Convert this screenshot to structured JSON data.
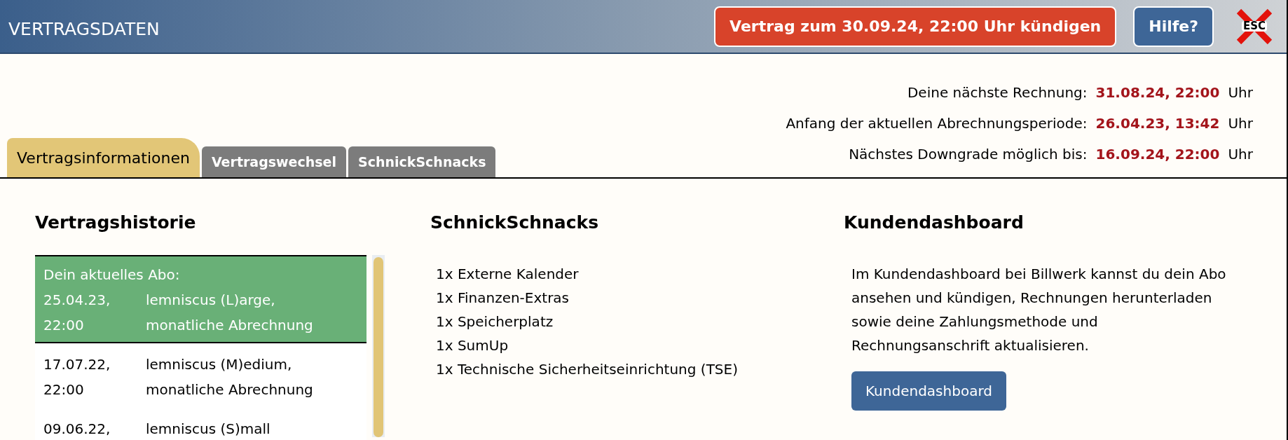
{
  "header": {
    "title": "VERTRAGSDATEN",
    "cancel_button": "Vertrag zum 30.09.24, 22:00 Uhr kündigen",
    "help_button": "Hilfe?",
    "esc_label": "ESC"
  },
  "info": [
    {
      "label": "Deine nächste Rechnung:",
      "value": "31.08.24, 22:00",
      "unit": "Uhr"
    },
    {
      "label": "Anfang der aktuellen Abrechnungsperiode:",
      "value": "26.04.23, 13:42",
      "unit": "Uhr"
    },
    {
      "label": "Nächstes Downgrade möglich bis:",
      "value": "16.09.24, 22:00",
      "unit": "Uhr"
    }
  ],
  "tabs": [
    {
      "label": "Vertragsinformationen",
      "selected": true
    },
    {
      "label": "Vertragswechsel",
      "selected": false
    },
    {
      "label": "SchnickSchnacks",
      "selected": false
    }
  ],
  "history": {
    "title": "Vertragshistorie",
    "current_label": "Dein aktuelles Abo:",
    "rows": [
      {
        "date": "25.04.23,",
        "time": "22:00",
        "plan": "lemniscus (L)arge,",
        "billing": "monatliche Abrechnung",
        "current": true
      },
      {
        "date": "17.07.22,",
        "time": "22:00",
        "plan": "lemniscus (M)edium,",
        "billing": "monatliche Abrechnung",
        "current": false
      },
      {
        "date": "09.06.22,",
        "plan": "lemniscus (S)mall",
        "current": false
      }
    ]
  },
  "extras": {
    "title": "SchnickSchnacks",
    "items": [
      "1x Externe Kalender",
      "1x Finanzen-Extras",
      "1x Speicherplatz",
      "1x SumUp",
      "1x Technische Sicherheitseinrichtung (TSE)"
    ]
  },
  "dashboard": {
    "title": "Kundendashboard",
    "text": "Im Kundendashboard bei Billwerk kannst du dein Abo ansehen und kündigen, Rechnungen herunterladen sowie deine Zahlungsmethode und Rechnungsanschrift aktualisieren.",
    "button": "Kundendashboard"
  }
}
